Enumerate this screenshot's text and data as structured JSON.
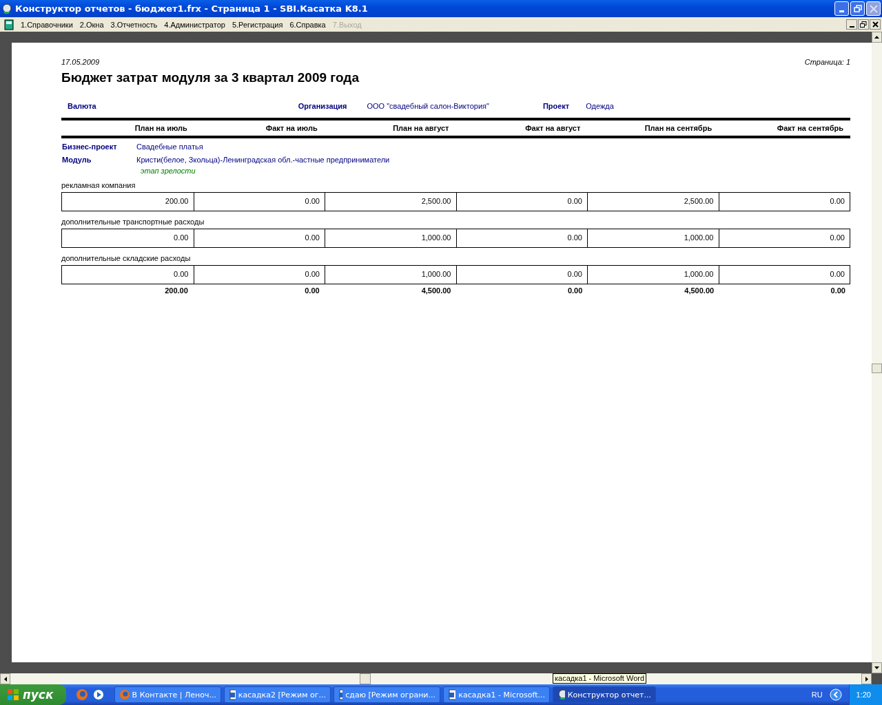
{
  "window": {
    "title": "Конструктор отчетов - бюджет1.frx - Страница 1 - SBI.Касатка K8.1"
  },
  "menu": [
    {
      "label": "1.Справочники",
      "disabled": false
    },
    {
      "label": "2.Окна",
      "disabled": false
    },
    {
      "label": "3.Отчетность",
      "disabled": false
    },
    {
      "label": "4.Администратор",
      "disabled": false
    },
    {
      "label": "5.Регистрация",
      "disabled": false
    },
    {
      "label": "6.Справка",
      "disabled": false
    },
    {
      "label": "7.Выход",
      "disabled": true
    }
  ],
  "report": {
    "date": "17.05.2009",
    "page": "Страница: 1",
    "title": "Бюджет затрат модуля за 3 квартал 2009 года",
    "params": [
      {
        "label": "Валюта"
      },
      {
        "label": "Организация",
        "value": "ООО \"свадебный салон-Виктория\""
      },
      {
        "label": "Проект",
        "value": "Одежда"
      }
    ],
    "columns": [
      "План на июль",
      "Факт на июль",
      "План на август",
      "Факт на август",
      "План на сентябрь",
      "Факт на сентябрь"
    ],
    "business_project": {
      "label": "Бизнес-проект",
      "value": "Свадебные платья"
    },
    "module": {
      "label": "Модуль",
      "value": "Кристи(белое, Зкольца)-Ленинградская обл.-частные предприниматели"
    },
    "stage": "этап зрелости",
    "groups": [
      {
        "name": "рекламная компания",
        "values": [
          "200.00",
          "0.00",
          "2,500.00",
          "0.00",
          "2,500.00",
          "0.00"
        ]
      },
      {
        "name": "дополнительные транспортные расходы",
        "values": [
          "0.00",
          "0.00",
          "1,000.00",
          "0.00",
          "1,000.00",
          "0.00"
        ]
      },
      {
        "name": "дополнительные складские расходы",
        "values": [
          "0.00",
          "0.00",
          "1,000.00",
          "0.00",
          "1,000.00",
          "0.00"
        ]
      }
    ],
    "totals": [
      "200.00",
      "0.00",
      "4,500.00",
      "0.00",
      "4,500.00",
      "0.00"
    ]
  },
  "tooltip": "касадка1 - Microsoft Word",
  "taskbar": {
    "start": "пуск",
    "buttons": [
      {
        "label": "В Контакте | Леноч...",
        "kind": "browser",
        "selected": false
      },
      {
        "label": "касадка2 [Режим ог...",
        "kind": "word",
        "selected": false
      },
      {
        "label": "сдаю [Режим ограни...",
        "kind": "word",
        "selected": false
      },
      {
        "label": "касадка1 - Microsoft...",
        "kind": "word",
        "selected": false
      },
      {
        "label": "Конструктор отчет...",
        "kind": "app",
        "selected": true
      }
    ],
    "language": "RU",
    "clock": "1:20"
  }
}
